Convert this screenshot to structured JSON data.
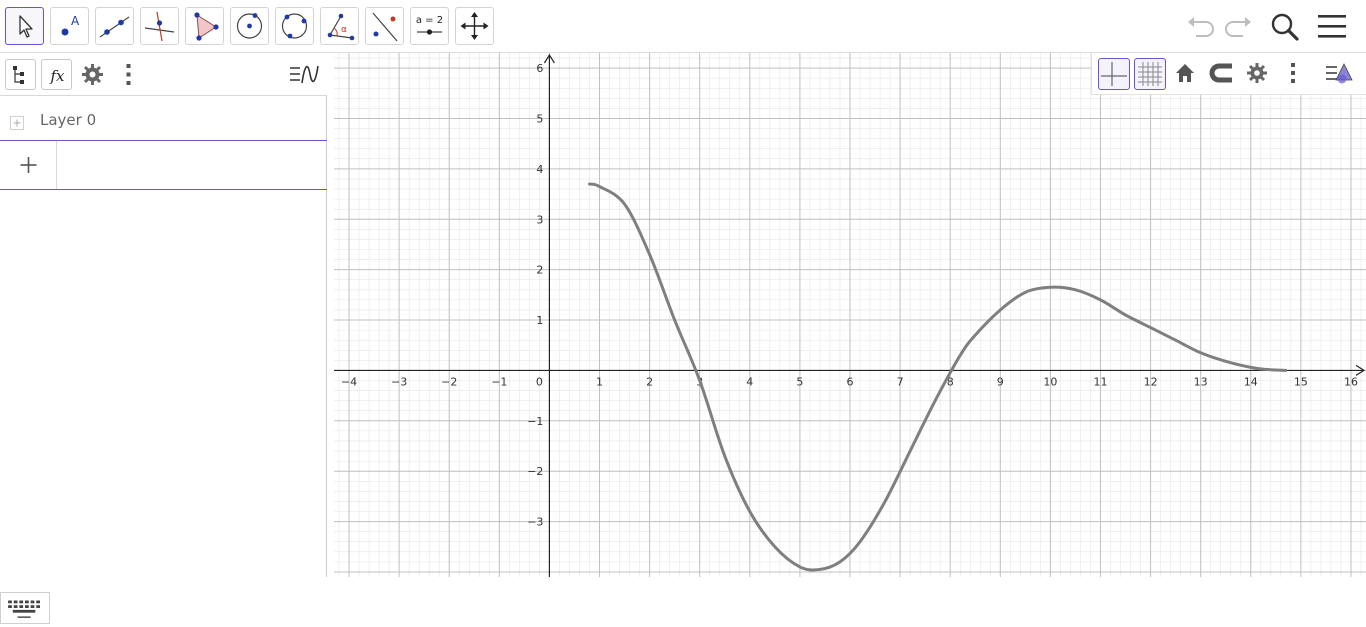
{
  "toolbar": {
    "tools": [
      {
        "name": "move-tool",
        "icon": "cursor-arrow-icon",
        "selected": true
      },
      {
        "name": "point-tool",
        "icon": "point-A-icon",
        "label": "A"
      },
      {
        "name": "line-tool",
        "icon": "line-through-two-points-icon"
      },
      {
        "name": "perpendicular-line-tool",
        "icon": "perpendicular-line-icon"
      },
      {
        "name": "polygon-tool",
        "icon": "polygon-icon"
      },
      {
        "name": "circle-center-point-tool",
        "icon": "circle-center-icon"
      },
      {
        "name": "circle-three-points-tool",
        "icon": "circle-three-points-icon"
      },
      {
        "name": "angle-tool",
        "icon": "angle-icon",
        "label": "α"
      },
      {
        "name": "reflect-tool",
        "icon": "reflect-about-line-icon"
      },
      {
        "name": "slider-tool",
        "icon": "slider-icon",
        "label": "a = 2"
      },
      {
        "name": "move-graphics-view-tool",
        "icon": "move-view-arrows-icon"
      }
    ],
    "right": {
      "undo_icon": "undo-icon",
      "redo_icon": "redo-icon",
      "search_icon": "search-icon",
      "menu_icon": "hamburger-menu-icon"
    }
  },
  "algebra": {
    "header_icons": [
      "algebra-tree-icon",
      "fx-icon",
      "gear-icon",
      "more-vertical-icon",
      "graphics-view-icon"
    ],
    "fx_label": "fx",
    "layer": {
      "label": "Layer 0"
    },
    "input_plus": "+"
  },
  "graphics": {
    "style_bar_icons": [
      "axes-icon",
      "grid-icon",
      "home-icon",
      "magnet-icon",
      "gear-icon",
      "more-vertical-icon",
      "style-bar-toggle-icon"
    ],
    "axes": {
      "x_ticks": [
        "−4",
        "−3",
        "−2",
        "−1",
        "0",
        "1",
        "2",
        "3",
        "4",
        "5",
        "6",
        "7",
        "8",
        "9",
        "10",
        "11",
        "12",
        "13",
        "14",
        "15",
        "16"
      ],
      "y_ticks_positive": [
        "1",
        "2",
        "3",
        "4",
        "5",
        "6"
      ],
      "y_ticks_negative": [
        "−1",
        "−2",
        "−3"
      ]
    },
    "colors": {
      "accent": "#6557d2",
      "grid_major": "#c0c0c0",
      "grid_minor": "#e6e6e6",
      "axis": "#252525",
      "curve": "#7f7f7f"
    }
  },
  "chart_data": {
    "type": "line",
    "xlim": [
      -4.3,
      16.3
    ],
    "ylim": [
      -4.1,
      6.3
    ],
    "grid": true,
    "series": [
      {
        "x": [
          0.8,
          1.0,
          1.5,
          2.0,
          2.5,
          3.0,
          3.5,
          4.0,
          4.5,
          5.0,
          5.4,
          5.8,
          6.2,
          6.7,
          7.2,
          7.7,
          8.2,
          8.5,
          9.0,
          9.5,
          10.0,
          10.5,
          11.0,
          11.5,
          12.0,
          12.5,
          13.0,
          13.5,
          14.0,
          14.3,
          14.7
        ],
        "y": [
          3.7,
          3.65,
          3.3,
          2.3,
          1.0,
          -0.2,
          -1.7,
          -2.8,
          -3.5,
          -3.9,
          -3.95,
          -3.8,
          -3.4,
          -2.6,
          -1.6,
          -0.6,
          0.3,
          0.7,
          1.2,
          1.55,
          1.65,
          1.6,
          1.4,
          1.1,
          0.85,
          0.6,
          0.35,
          0.18,
          0.06,
          0.02,
          0.0
        ]
      }
    ]
  }
}
